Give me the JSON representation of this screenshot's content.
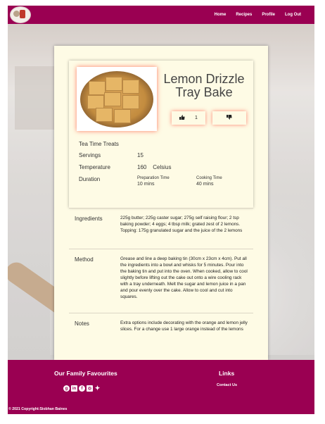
{
  "nav": {
    "links": [
      "Home",
      "Recipes",
      "Profile",
      "Log Out"
    ]
  },
  "recipe": {
    "title": "Lemon Drizzle Tray Bake",
    "likes": "1",
    "category": "Tea Time Treats",
    "servings_label": "Servings",
    "servings": "15",
    "temperature_label": "Temperature",
    "temperature": "160",
    "temperature_unit": "Celsius",
    "duration_label": "Duration",
    "prep_label": "Preparation Time",
    "prep_time": "10 mins",
    "cook_label": "Cooking Time",
    "cook_time": "40 mins",
    "ingredients_label": "Ingredients",
    "ingredients": "225g butter; 225g caster sugar; 275g self raising flour; 2 tsp baking powder; 4 eggs; 4 tbsp milk; grated zest of 2 lemons. Topping: 175g granulated sugar and the juice of the 2 lemons",
    "method_label": "Method",
    "method": "Grease and line a deep baking tin (30cm x 23cm x 4cm). Put all the ingredients into a bowl and whisks for 5 minutes. Pour into the baking tin and put into the oven. When cooked, allow to cool slightly before lifting out the cake out onto a wire cooling rack with a tray underneath. Melt the sugar and lemon juice in a pan and pour evenly over the cake. Allow to cool and cut into squares.",
    "notes_label": "Notes",
    "notes": "Extra options include decorating with the orange and lemon jelly slices. For a change use 1 large orange instead of the lemons"
  },
  "footer": {
    "favourites_title": "Our Family Favourites",
    "links_title": "Links",
    "contact": "Contact Us",
    "copyright": "© 2021 Copyright:Siobhan Baines"
  },
  "colors": {
    "brand": "#9a0052",
    "card": "#fefbe5",
    "accent_glow": "#ff6e5a"
  },
  "icons": {
    "like": "thumbs-up-icon",
    "dislike": "thumbs-down-icon",
    "social": [
      "github-icon",
      "linkedin-icon",
      "facebook-icon",
      "instagram-icon",
      "twitter-icon"
    ]
  }
}
